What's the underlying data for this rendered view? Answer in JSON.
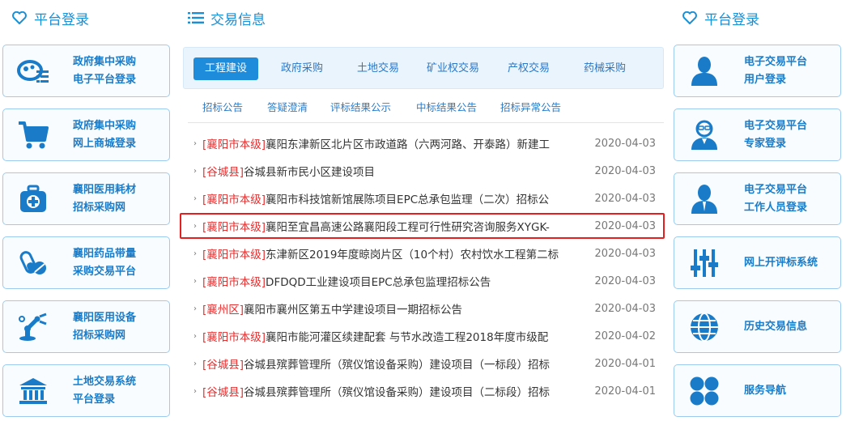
{
  "left": {
    "heading": "平台登录",
    "cards": [
      {
        "line1": "政府集中采购",
        "line2": "电子平台登录",
        "icon": "gov-procurement-login-icon"
      },
      {
        "line1": "政府集中采购",
        "line2": "网上商城登录",
        "icon": "shopping-cart-icon"
      },
      {
        "line1": "襄阳医用耗材",
        "line2": "招标采购网",
        "icon": "medical-kit-icon"
      },
      {
        "line1": "襄阳药品带量",
        "line2": "采购交易平台",
        "icon": "pill-icon"
      },
      {
        "line1": "襄阳医用设备",
        "line2": "招标采购网",
        "icon": "robot-arm-icon"
      },
      {
        "line1": "土地交易系统",
        "line2": "平台登录",
        "icon": "bank-building-icon"
      }
    ]
  },
  "middle": {
    "heading": "交易信息",
    "tabs": [
      "工程建设",
      "政府采购",
      "土地交易",
      "矿业权交易",
      "产权交易",
      "药械采购"
    ],
    "subtabs": [
      "招标公告",
      "答疑澄清",
      "评标结果公示",
      "中标结果公告",
      "招标异常公告"
    ],
    "news": [
      {
        "region": "[襄阳市本级]",
        "title": "襄阳东津新区北片区市政道路（六两河路、开泰路）新建工",
        "date": "2020-04-03"
      },
      {
        "region": "[谷城县]",
        "title": "谷城县新市民小区建设项目",
        "date": "2020-04-03"
      },
      {
        "region": "[襄阳市本级]",
        "title": "襄阳市科技馆新馆展陈项目EPC总承包监理（二次）招标公",
        "date": "2020-04-03"
      },
      {
        "region": "[襄阳市本级]",
        "title": "襄阳至宜昌高速公路襄阳段工程可行性研究咨询服务XYGK-",
        "date": "2020-04-03"
      },
      {
        "region": "[襄阳市本级]",
        "title": "东津新区2019年度晾岗片区（10个村）农村饮水工程第二标",
        "date": "2020-04-03"
      },
      {
        "region": "[襄阳市本级]",
        "title": "DFDQD工业建设项目EPC总承包监理招标公告",
        "date": "2020-04-03"
      },
      {
        "region": "[襄州区]",
        "title": "襄阳市襄州区第五中学建设项目一期招标公告",
        "date": "2020-04-03"
      },
      {
        "region": "[襄阳市本级]",
        "title": "襄阳市能河灌区续建配套 与节水改造工程2018年度市级配",
        "date": "2020-04-02"
      },
      {
        "region": "[谷城县]",
        "title": "谷城县殡葬管理所（殡仪馆设备采购）建设项目（一标段）招标",
        "date": "2020-04-01"
      },
      {
        "region": "[谷城县]",
        "title": "谷城县殡葬管理所（殡仪馆设备采购）建设项目（二标段）招标",
        "date": "2020-04-01"
      }
    ]
  },
  "right": {
    "heading": "平台登录",
    "cards": [
      {
        "line1": "电子交易平台",
        "line2": "用户登录",
        "icon": "user-icon"
      },
      {
        "line1": "电子交易平台",
        "line2": "专家登录",
        "icon": "expert-icon"
      },
      {
        "line1": "电子交易平台",
        "line2": "工作人员登录",
        "icon": "staff-icon"
      },
      {
        "line1": "网上开评标系统",
        "line2": "",
        "icon": "sliders-icon"
      },
      {
        "line1": "历史交易信息",
        "line2": "",
        "icon": "globe-icon"
      },
      {
        "line1": "服务导航",
        "line2": "",
        "icon": "grid-icon"
      }
    ]
  },
  "colors": {
    "accent": "#1e8cdb",
    "region_red": "#e53030",
    "highlight_border": "#e51f1f",
    "card_border": "#9ccbef"
  }
}
